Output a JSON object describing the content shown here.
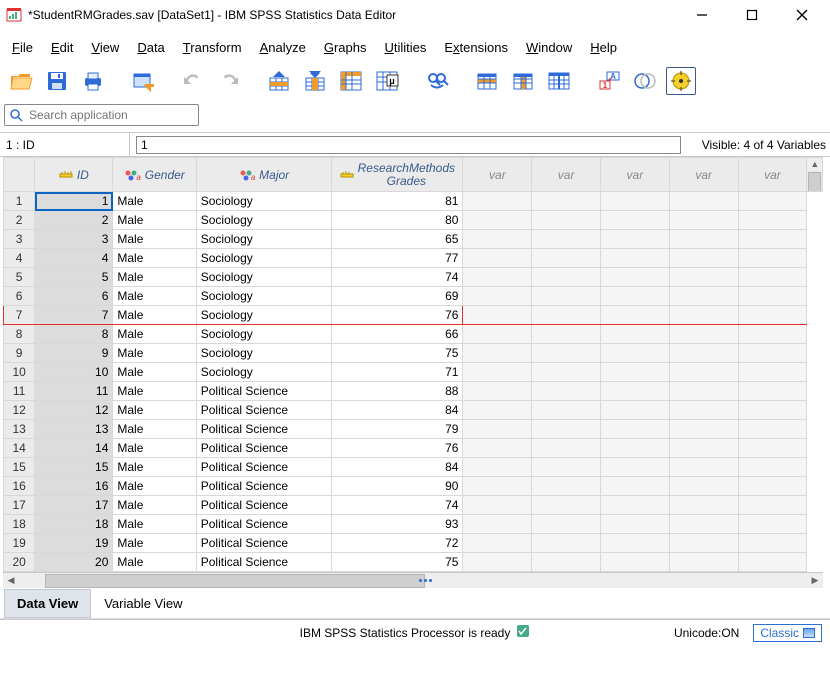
{
  "window": {
    "title": "*StudentRMGrades.sav [DataSet1] - IBM SPSS Statistics Data Editor"
  },
  "menu": {
    "file": "File",
    "edit": "Edit",
    "view": "View",
    "data": "Data",
    "transform": "Transform",
    "analyze": "Analyze",
    "graphs": "Graphs",
    "utilities": "Utilities",
    "extensions": "Extensions",
    "window": "Window",
    "help": "Help"
  },
  "search": {
    "placeholder": "Search application"
  },
  "refbar": {
    "ref": "1 : ID",
    "value": "1",
    "visible": "Visible: 4 of 4 Variables"
  },
  "columns": {
    "id": "ID",
    "gender": "Gender",
    "major": "Major",
    "grades_l1": "ResearchMethods",
    "grades_l2": "Grades",
    "var": "var"
  },
  "rows": [
    {
      "n": 1,
      "id": 1,
      "gender": "Male",
      "major": "Sociology",
      "grade": 81
    },
    {
      "n": 2,
      "id": 2,
      "gender": "Male",
      "major": "Sociology",
      "grade": 80
    },
    {
      "n": 3,
      "id": 3,
      "gender": "Male",
      "major": "Sociology",
      "grade": 65
    },
    {
      "n": 4,
      "id": 4,
      "gender": "Male",
      "major": "Sociology",
      "grade": 77
    },
    {
      "n": 5,
      "id": 5,
      "gender": "Male",
      "major": "Sociology",
      "grade": 74
    },
    {
      "n": 6,
      "id": 6,
      "gender": "Male",
      "major": "Sociology",
      "grade": 69
    },
    {
      "n": 7,
      "id": 7,
      "gender": "Male",
      "major": "Sociology",
      "grade": 76
    },
    {
      "n": 8,
      "id": 8,
      "gender": "Male",
      "major": "Sociology",
      "grade": 66
    },
    {
      "n": 9,
      "id": 9,
      "gender": "Male",
      "major": "Sociology",
      "grade": 75
    },
    {
      "n": 10,
      "id": 10,
      "gender": "Male",
      "major": "Sociology",
      "grade": 71
    },
    {
      "n": 11,
      "id": 11,
      "gender": "Male",
      "major": "Political Science",
      "grade": 88
    },
    {
      "n": 12,
      "id": 12,
      "gender": "Male",
      "major": "Political Science",
      "grade": 84
    },
    {
      "n": 13,
      "id": 13,
      "gender": "Male",
      "major": "Political Science",
      "grade": 79
    },
    {
      "n": 14,
      "id": 14,
      "gender": "Male",
      "major": "Political Science",
      "grade": 76
    },
    {
      "n": 15,
      "id": 15,
      "gender": "Male",
      "major": "Political Science",
      "grade": 84
    },
    {
      "n": 16,
      "id": 16,
      "gender": "Male",
      "major": "Political Science",
      "grade": 90
    },
    {
      "n": 17,
      "id": 17,
      "gender": "Male",
      "major": "Political Science",
      "grade": 74
    },
    {
      "n": 18,
      "id": 18,
      "gender": "Male",
      "major": "Political Science",
      "grade": 93
    },
    {
      "n": 19,
      "id": 19,
      "gender": "Male",
      "major": "Political Science",
      "grade": 72
    },
    {
      "n": 20,
      "id": 20,
      "gender": "Male",
      "major": "Political Science",
      "grade": 75
    }
  ],
  "highlight_row": 7,
  "selected": {
    "row": 1,
    "col": "id"
  },
  "tabs": {
    "data_view": "Data View",
    "variable_view": "Variable View",
    "active": "data_view"
  },
  "status": {
    "processor": "IBM SPSS Statistics Processor is ready",
    "unicode": "Unicode:ON",
    "classic": "Classic"
  }
}
